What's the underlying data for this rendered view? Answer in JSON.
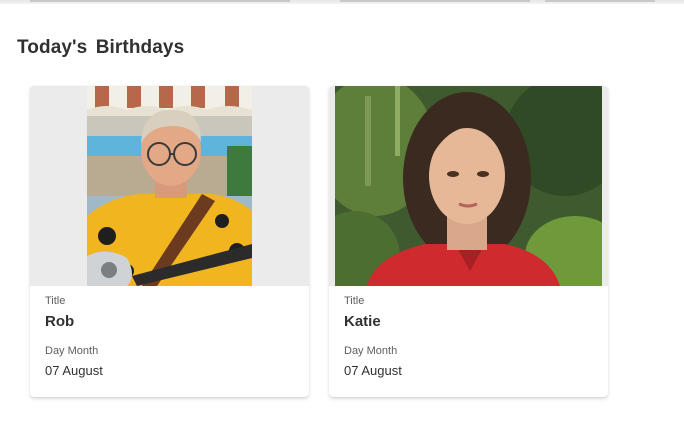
{
  "section": {
    "title": "Today's  Birthdays"
  },
  "cards": [
    {
      "title_label": "Title",
      "name": "Rob",
      "date_label": "Day Month",
      "date": "07 August",
      "photo": "photo-man-with-guitar"
    },
    {
      "title_label": "Title",
      "name": "Katie",
      "date_label": "Day Month",
      "date": "07 August",
      "photo": "photo-woman-in-red-top"
    }
  ],
  "colors": {
    "card_bg": "#ffffff",
    "media_bg": "#ebebeb",
    "label": "#605e5c",
    "text": "#323130"
  }
}
